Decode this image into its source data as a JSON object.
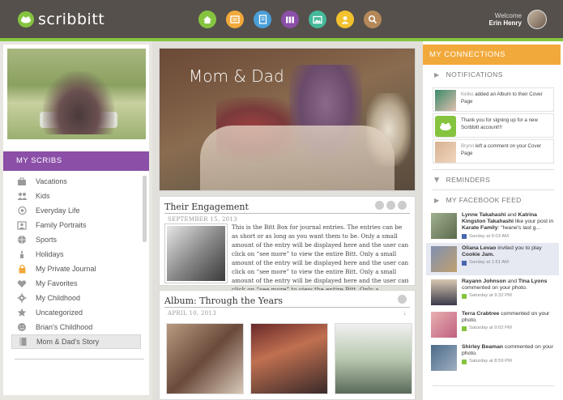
{
  "header": {
    "logo_text": "scribbitt",
    "nav_icons": [
      {
        "name": "home-icon",
        "color": "#86c440"
      },
      {
        "name": "blog-icon",
        "color": "#f2a93b"
      },
      {
        "name": "journal-icon",
        "color": "#4a9fd8"
      },
      {
        "name": "books-icon",
        "color": "#8b4fa8"
      },
      {
        "name": "photos-icon",
        "color": "#45b99a"
      },
      {
        "name": "profile-icon",
        "color": "#f2c12e"
      },
      {
        "name": "search-icon",
        "color": "#b5885a"
      }
    ],
    "welcome_label": "Welcome",
    "user_name": "Erin Henry"
  },
  "left": {
    "section_title": "MY SCRIBS",
    "items": [
      {
        "label": "Vacations",
        "icon": "suitcase-icon"
      },
      {
        "label": "Kids",
        "icon": "people-icon"
      },
      {
        "label": "Everyday Life",
        "icon": "cloud-icon"
      },
      {
        "label": "Family Portraits",
        "icon": "portrait-icon"
      },
      {
        "label": "Sports",
        "icon": "ball-icon"
      },
      {
        "label": "Holidays",
        "icon": "holiday-icon"
      },
      {
        "label": "My Private Journal",
        "icon": "lock-icon"
      },
      {
        "label": "My Favorites",
        "icon": "heart-icon"
      },
      {
        "label": "My Childhood",
        "icon": "gear-icon"
      },
      {
        "label": "Uncategorized",
        "icon": "star-icon"
      },
      {
        "label": "Brian's Childhood",
        "icon": "smile-icon"
      },
      {
        "label": "Mom & Dad's Story",
        "icon": "book-icon"
      }
    ],
    "active_index": 11
  },
  "center": {
    "cover_title": "Mom & Dad",
    "post": {
      "title": "Their Engagement",
      "date": "SEPTEMBER 15, 2013",
      "body": "This is the Bitt Box for journal entries. The entries can be as short or as long as you want them to be. Only a small amount of the entry will be displayed here and the user can click on “see more” to view the entire Bitt. Only a small amount of the entry will be displayed here and the user can click on “see more” to view the entire Bitt. Only a small amount of the entry will be displayed here and the user can click on “see more” to view the entire Bitt. Only a"
    },
    "album": {
      "title": "Album: Through the Years",
      "date": "APRIL 10, 2013"
    }
  },
  "right": {
    "section_title": "MY CONNECTIONS",
    "notifications_label": "NOTIFICATIONS",
    "notifications": [
      {
        "user": "Keiko",
        "text": "added an Album to their Cover Page"
      },
      {
        "user": "",
        "text": "Thank you for signing up for a new Scribbitt account!!!"
      },
      {
        "user": "Brynn",
        "text": "left a comment on your Cover Page"
      }
    ],
    "reminders_label": "REMINDERS",
    "facebook_label": "MY FACEBOOK FEED",
    "feed": [
      {
        "bold1": "Lynne Takahashi",
        "mid": " and ",
        "bold2": "Katrina Kingston Takahashi",
        "rest": " like your post in ",
        "bold3": "Karate Family",
        "tail": ": “Iwane's last g...",
        "time": "Sunday at 6:03 AM"
      },
      {
        "bold1": "Oliana Levao",
        "mid": " invited you to play ",
        "bold2": "Cookie Jam.",
        "rest": "",
        "bold3": "",
        "tail": "",
        "time": "Sunday at 1:51 AM"
      },
      {
        "bold1": "Rayann Johnson",
        "mid": " and ",
        "bold2": "Tina Lyons",
        "rest": " commented on your photo.",
        "bold3": "",
        "tail": "",
        "time": "Saturday at 9:32 PM"
      },
      {
        "bold1": "Terra Crabtree",
        "mid": " commented on your photo.",
        "bold2": "",
        "rest": "",
        "bold3": "",
        "tail": "",
        "time": "Saturday at 9:02 PM"
      },
      {
        "bold1": "Shirley Beaman",
        "mid": " commented on your photo.",
        "bold2": "",
        "rest": "",
        "bold3": "",
        "tail": "",
        "time": "Saturday at 8:59 PM"
      }
    ]
  }
}
